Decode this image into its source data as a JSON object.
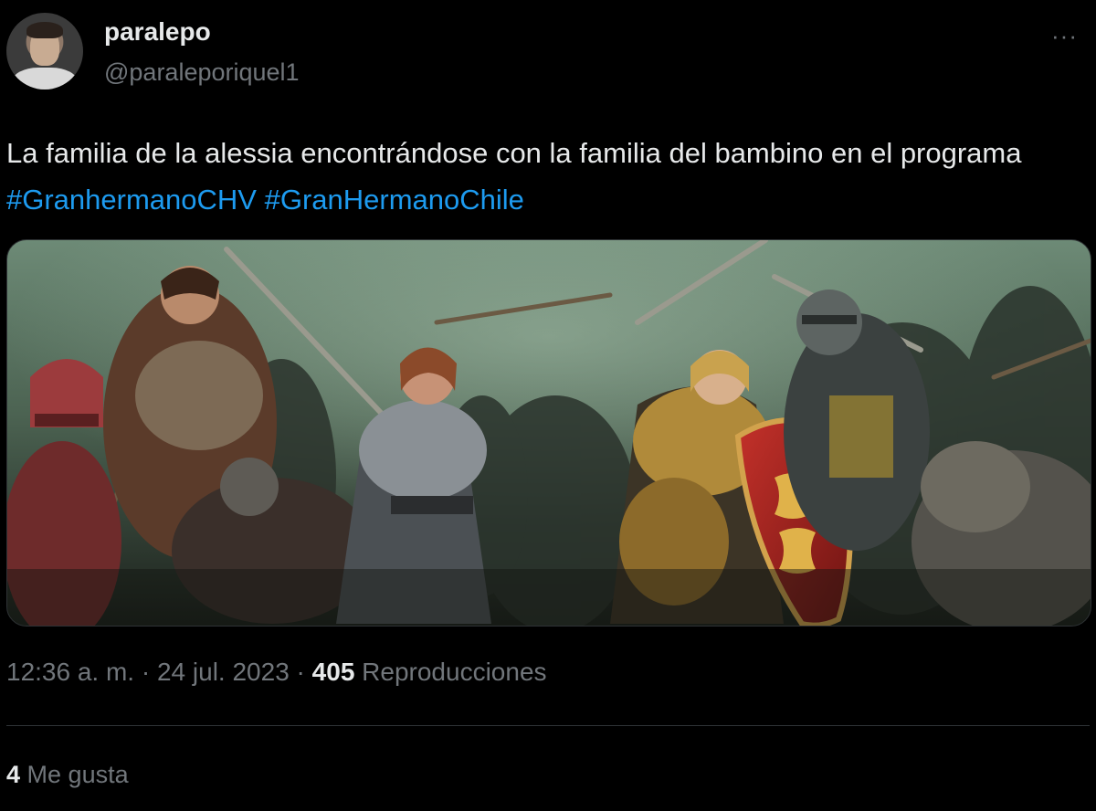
{
  "author": {
    "display_name": "paralepo",
    "handle": "@paraleporiquel1"
  },
  "more_label": "···",
  "tweet": {
    "text": "La familia de la alessia encontrándose con la familia del bambino en el programa ",
    "hashtags": [
      "#GranhermanoCHV",
      "#GranHermanoChile"
    ]
  },
  "media": {
    "icon": "image-icon"
  },
  "meta": {
    "time": "12:36 a. m.",
    "sep1": " · ",
    "date": "24 jul. 2023",
    "sep2": " · ",
    "views_count": "405",
    "views_label": "Reproducciones"
  },
  "likes": {
    "count": "4",
    "label": "Me gusta"
  },
  "colors": {
    "background": "#000000",
    "text": "#e7e9ea",
    "secondary": "#71767b",
    "link": "#1d9bf0",
    "divider": "#2f3336"
  }
}
